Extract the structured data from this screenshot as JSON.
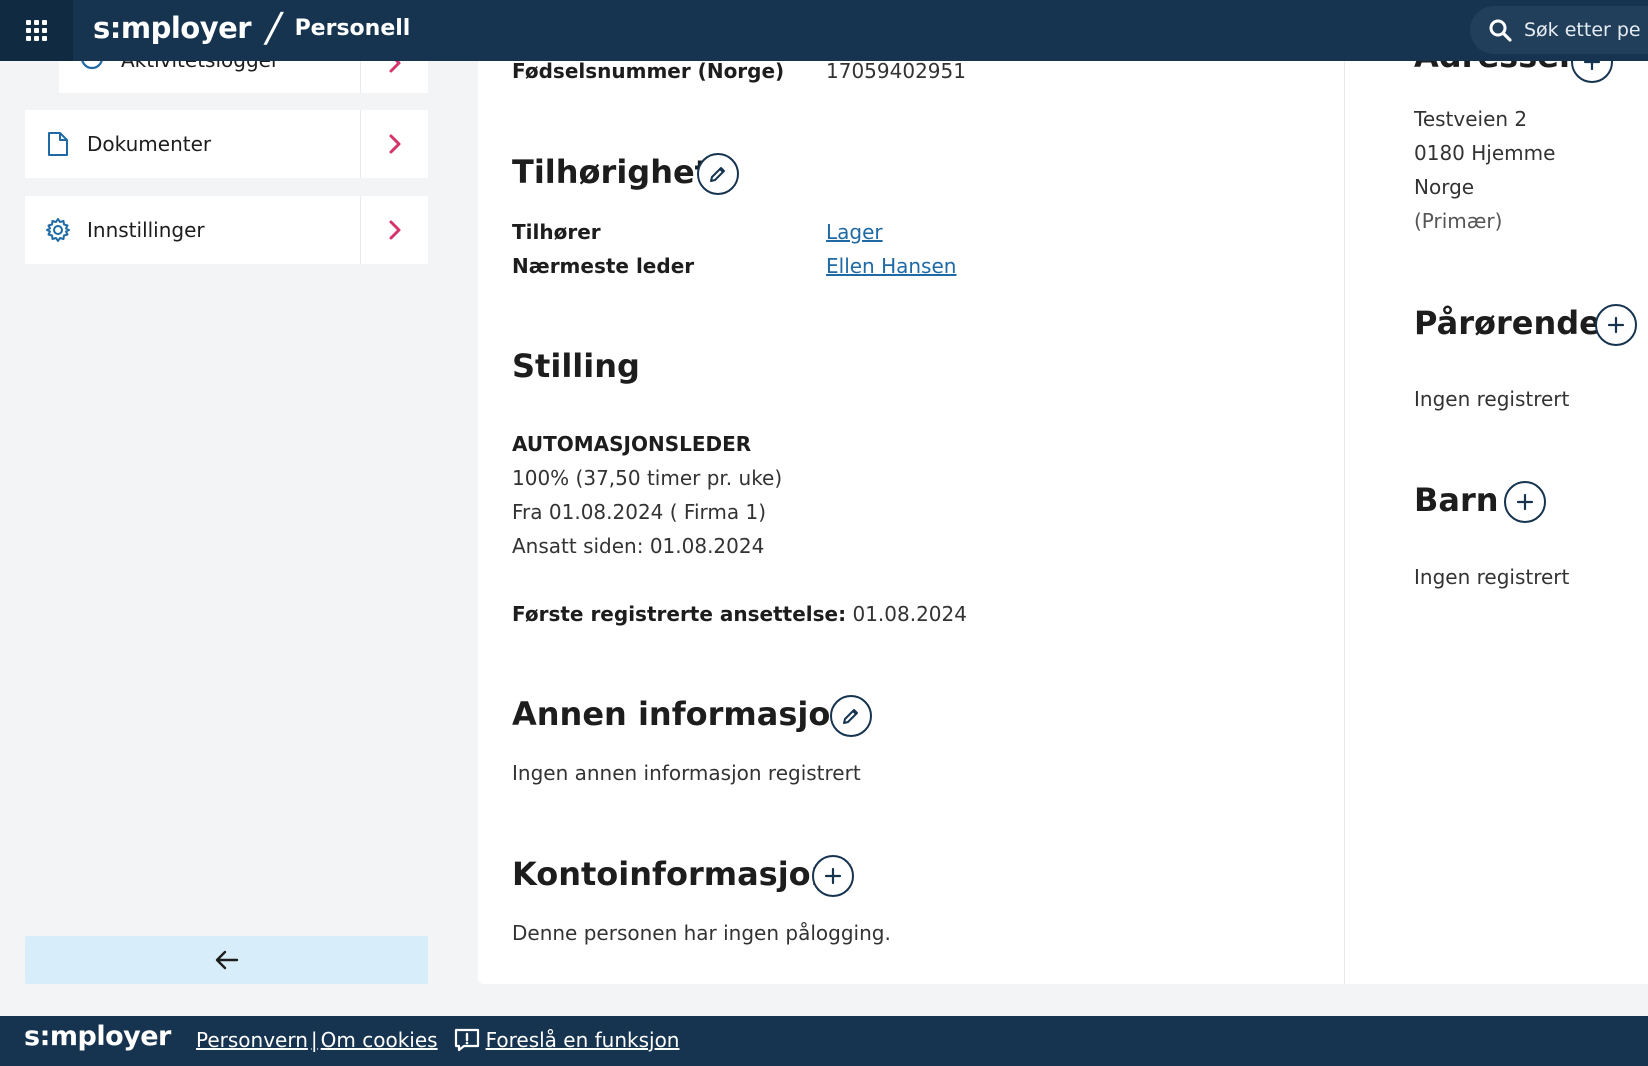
{
  "header": {
    "brand": "s:mployer",
    "slash": "/",
    "app_name": "Personell",
    "search_placeholder": "Søk etter pe"
  },
  "sidebar": {
    "items": [
      {
        "label": "Aktivitetslogger",
        "icon": "clock-icon"
      },
      {
        "label": "Dokumenter",
        "icon": "document-icon"
      },
      {
        "label": "Innstillinger",
        "icon": "gear-icon"
      }
    ],
    "back_icon": "arrow-left-icon"
  },
  "person": {
    "fodselsnummer_label": "Fødselsnummer (Norge)",
    "fodselsnummer_value": "17059402951"
  },
  "tilhorighet": {
    "title": "Tilhørighet",
    "tilhorer_label": "Tilhører",
    "tilhorer_value": "Lager",
    "leder_label": "Nærmeste leder",
    "leder_value": "Ellen Hansen"
  },
  "stilling": {
    "title": "Stilling",
    "position": "AUTOMASJONSLEDER",
    "percent": "100% (37,50 timer pr. uke)",
    "from": "Fra 01.08.2024 ( Firma 1)",
    "employed_since": "Ansatt siden: 01.08.2024",
    "first_reg_label": "Første registrerte ansettelse:",
    "first_reg_value": "01.08.2024"
  },
  "annen": {
    "title": "Annen informasjon",
    "text": "Ingen annen informasjon registrert"
  },
  "konto": {
    "title": "Kontoinformasjon",
    "text": "Denne personen har ingen pålogging."
  },
  "adresser": {
    "title": "Adresser",
    "line1": "Testveien 2",
    "line2": "0180 Hjemme",
    "line3": "Norge",
    "line4": "(Primær)"
  },
  "parorende": {
    "title": "Pårørende",
    "text": "Ingen registrert"
  },
  "barn": {
    "title": "Barn",
    "text": "Ingen registrert"
  },
  "footer": {
    "brand": "s:mployer",
    "personvern": "Personvern",
    "sep": "|",
    "cookies": "Om cookies",
    "suggest": "Foreslå en funksjon"
  },
  "colors": {
    "navy": "#16344f",
    "link": "#1f6aa5",
    "chevron": "#d6336c",
    "back_button_bg": "#d7edf9"
  }
}
